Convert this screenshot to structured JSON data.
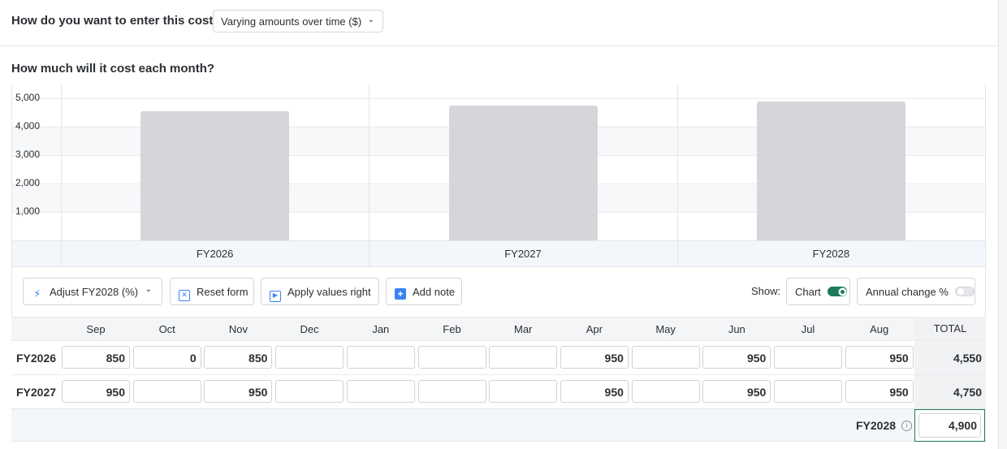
{
  "cost_entry": {
    "question": "How do you want to enter this cost?",
    "method": "Varying amounts over time ($)"
  },
  "monthly": {
    "question": "How much will it cost each month?"
  },
  "chart_data": {
    "type": "bar",
    "categories": [
      "FY2026",
      "FY2027",
      "FY2028"
    ],
    "values": [
      4550,
      4750,
      4900
    ],
    "yticks": [
      "1,000",
      "2,000",
      "3,000",
      "4,000",
      "5,000"
    ],
    "ylim": [
      0,
      5500
    ],
    "grid": true,
    "bar_color": "#d5d6d9"
  },
  "toolbar": {
    "adjust_label": "Adjust FY2028 (%)",
    "reset_label": "Reset form",
    "apply_label": "Apply values right",
    "note_label": "Add note",
    "show_label": "Show:",
    "chart_toggle_label": "Chart",
    "chart_toggle_on": true,
    "annual_toggle_label": "Annual change %",
    "annual_toggle_on": false
  },
  "table": {
    "months": [
      "Sep",
      "Oct",
      "Nov",
      "Dec",
      "Jan",
      "Feb",
      "Mar",
      "Apr",
      "May",
      "Jun",
      "Jul",
      "Aug"
    ],
    "total_header": "TOTAL",
    "rows": [
      {
        "label": "FY2026",
        "values": [
          "850",
          "0",
          "850",
          "",
          "",
          "",
          "",
          "950",
          "",
          "950",
          "",
          "950"
        ],
        "total": "4,550"
      },
      {
        "label": "FY2027",
        "values": [
          "950",
          "",
          "950",
          "",
          "",
          "",
          "",
          "950",
          "",
          "950",
          "",
          "950"
        ],
        "total": "4,750"
      }
    ],
    "fy2028": {
      "label": "FY2028",
      "info_icon": "i",
      "value": "4,900"
    }
  },
  "colors": {
    "accent": "#1d7a5c",
    "icon_blue": "#3b82f6"
  }
}
